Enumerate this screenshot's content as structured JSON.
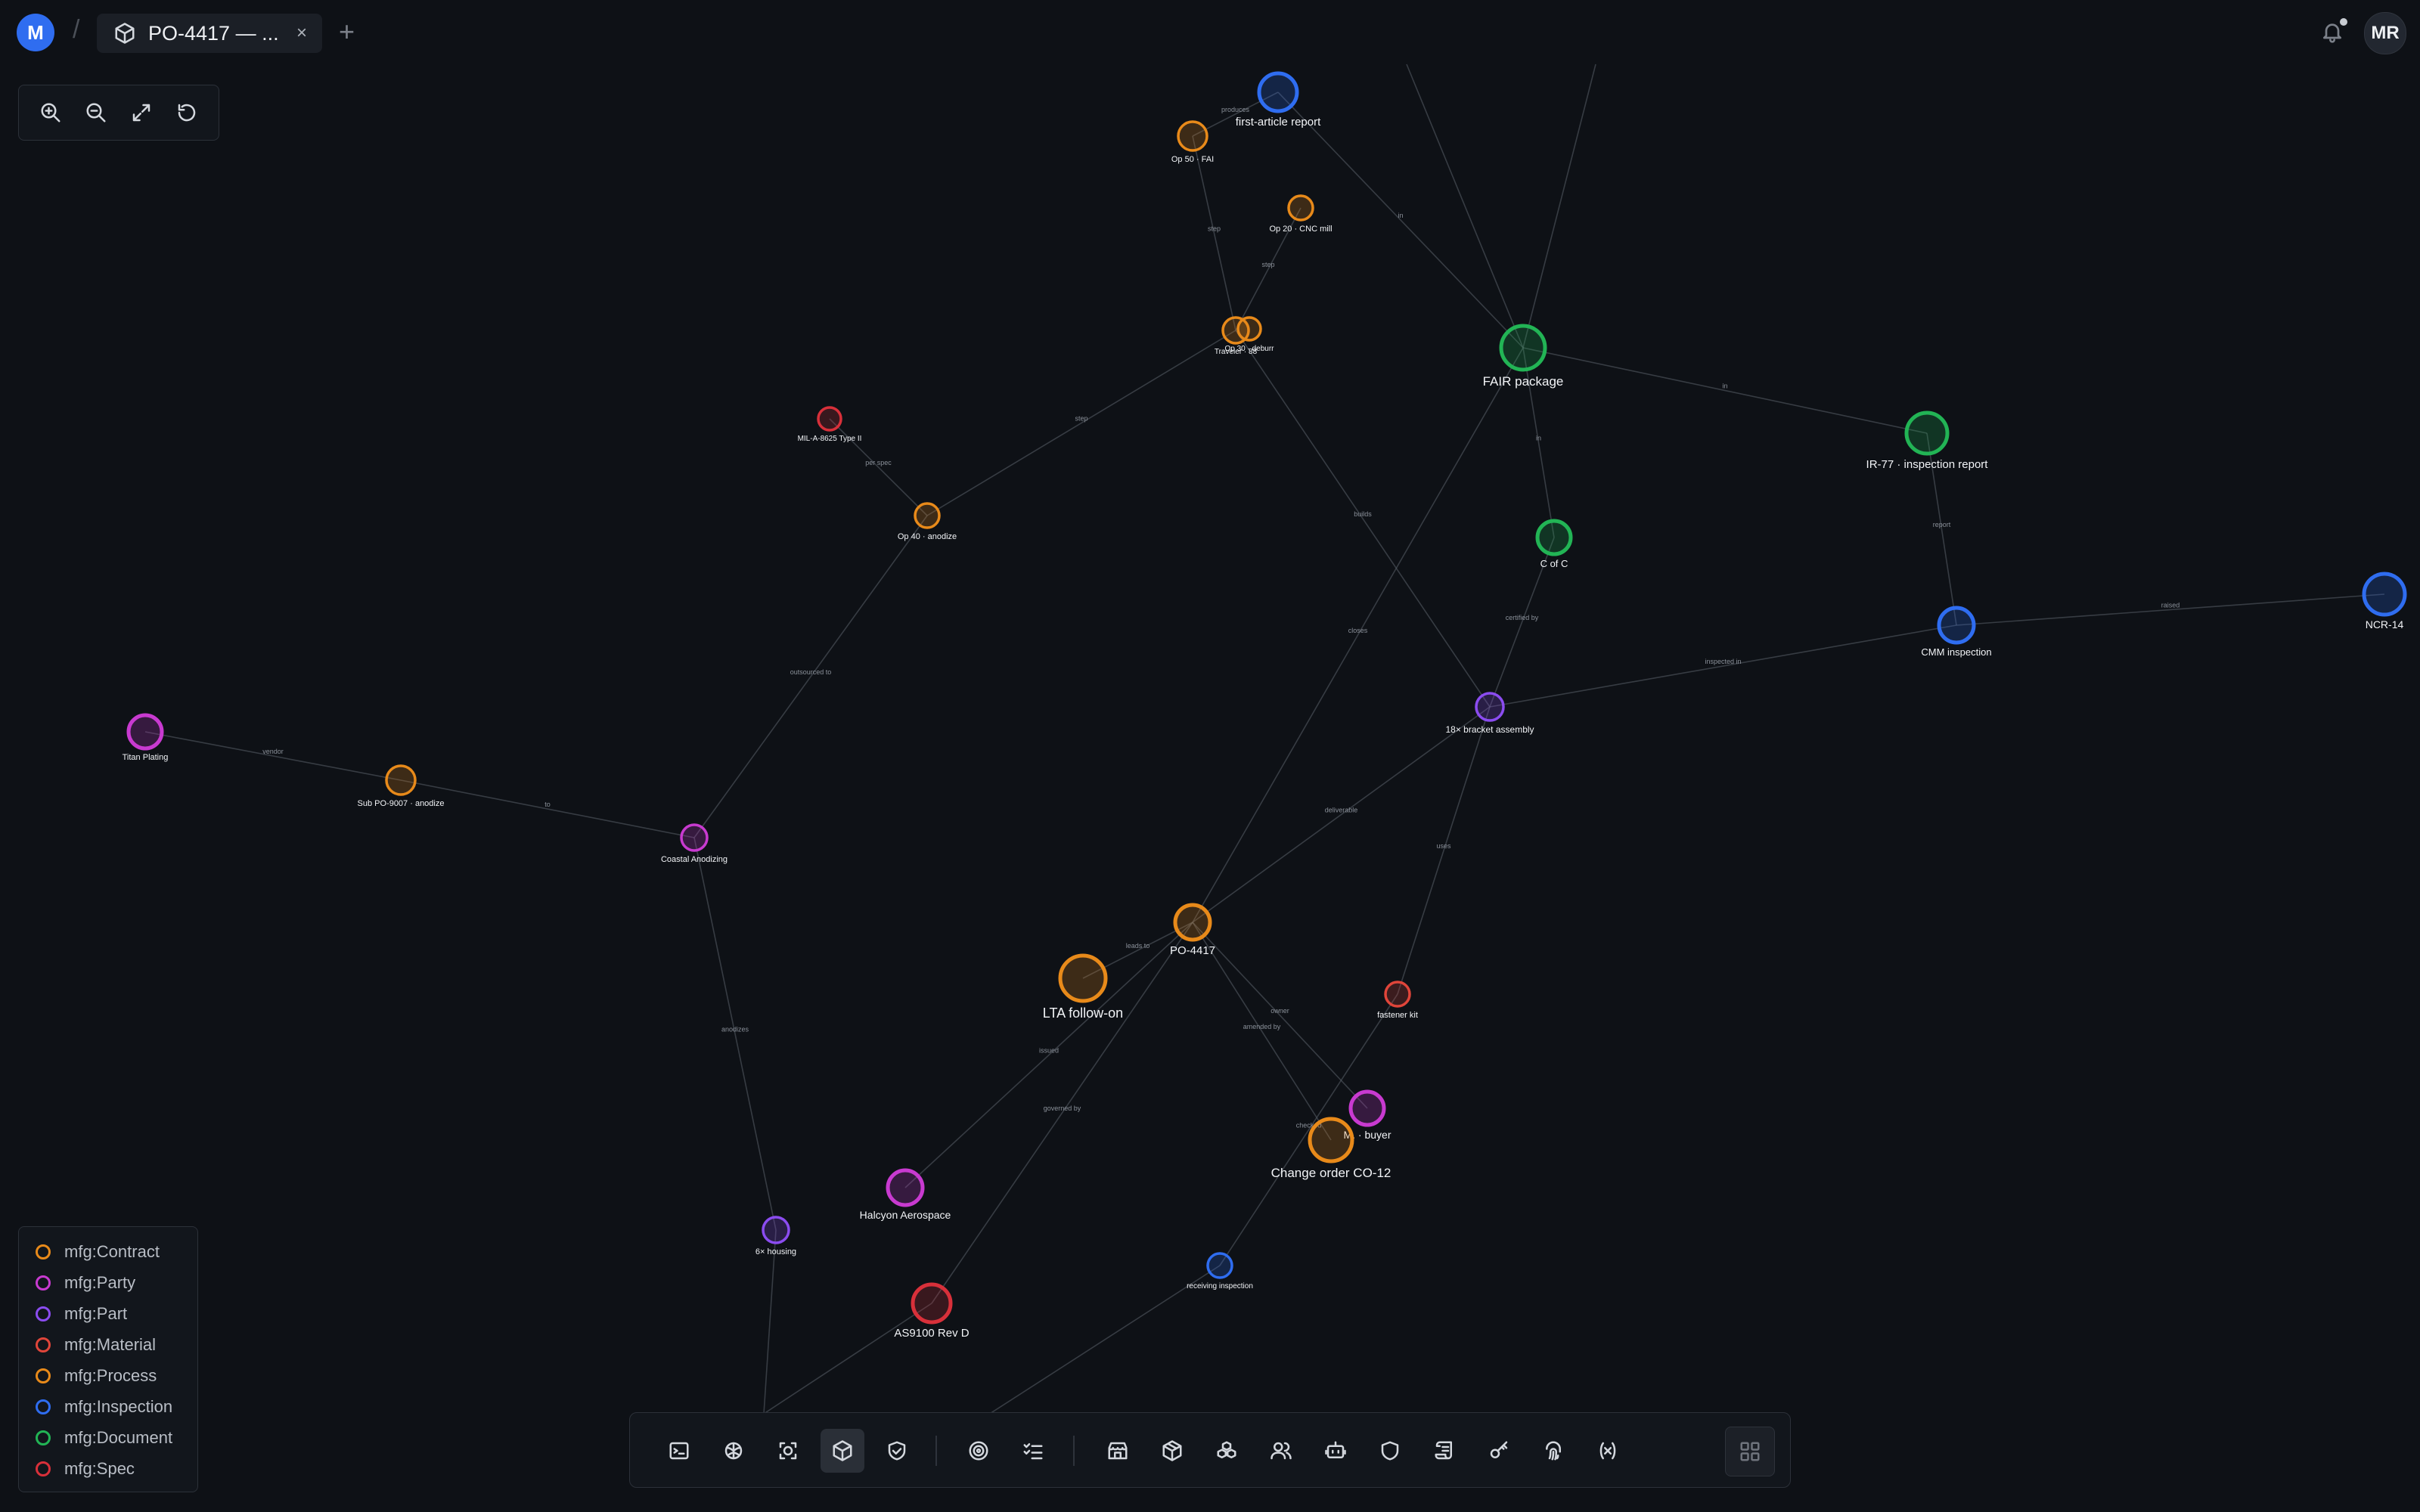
{
  "topbar": {
    "logo_letter": "M",
    "separator": "/",
    "tab_title": "PO-4417 — ...",
    "tab_close": "×",
    "new_tab": "+",
    "user_initials": "MR"
  },
  "zoom_controls": [
    "zoom-in",
    "zoom-out",
    "fit-view",
    "reset"
  ],
  "legend": [
    {
      "label": "mfg:Contract",
      "color": "#e88a1a"
    },
    {
      "label": "mfg:Party",
      "color": "#c83ad0"
    },
    {
      "label": "mfg:Part",
      "color": "#8b4cf0"
    },
    {
      "label": "mfg:Material",
      "color": "#e0453a"
    },
    {
      "label": "mfg:Process",
      "color": "#e88a1a"
    },
    {
      "label": "mfg:Inspection",
      "color": "#2f6df0"
    },
    {
      "label": "mfg:Document",
      "color": "#22b455"
    },
    {
      "label": "mfg:Spec",
      "color": "#d8303a"
    }
  ],
  "graph": {
    "nodes": [
      {
        "id": "fa_report",
        "label": "first-article report",
        "color": "#2f6df0"
      },
      {
        "id": "op50",
        "label": "Op 50 · FAI",
        "color": "#e88a1a"
      },
      {
        "id": "op20",
        "label": "Op 20 · CNC mill",
        "color": "#e88a1a"
      },
      {
        "id": "traveler",
        "label": "Traveler · 88",
        "color": "#e88a1a"
      },
      {
        "id": "op30",
        "label": "Op 30 · deburr",
        "color": "#e88a1a"
      },
      {
        "id": "fair",
        "label": "FAIR package",
        "color": "#22b455"
      },
      {
        "id": "ir77",
        "label": "IR-77 · inspection report",
        "color": "#22b455"
      },
      {
        "id": "mil",
        "label": "MIL-A-8625 Type II",
        "color": "#d8303a"
      },
      {
        "id": "op40",
        "label": "Op 40 · anodize",
        "color": "#e88a1a"
      },
      {
        "id": "cofc",
        "label": "C of C",
        "color": "#22b455"
      },
      {
        "id": "cmm",
        "label": "CMM inspection",
        "color": "#2f6df0"
      },
      {
        "id": "ncr14",
        "label": "NCR-14",
        "color": "#2f6df0"
      },
      {
        "id": "bracket",
        "label": "18× bracket assembly",
        "color": "#8b4cf0"
      },
      {
        "id": "titan",
        "label": "Titan Plating",
        "color": "#c83ad0"
      },
      {
        "id": "subpo",
        "label": "Sub PO-9007 · anodize",
        "color": "#e88a1a"
      },
      {
        "id": "coastal",
        "label": "Coastal Anodizing",
        "color": "#c83ad0"
      },
      {
        "id": "po4417",
        "label": "PO-4417",
        "color": "#e88a1a"
      },
      {
        "id": "lta",
        "label": "LTA follow-on",
        "color": "#e88a1a"
      },
      {
        "id": "fastener",
        "label": "fastener kit",
        "color": "#e0453a"
      },
      {
        "id": "buyer",
        "label": "M. · buyer",
        "color": "#c83ad0"
      },
      {
        "id": "co12",
        "label": "Change order CO-12",
        "color": "#e88a1a"
      },
      {
        "id": "halcyon",
        "label": "Halcyon Aerospace",
        "color": "#c83ad0"
      },
      {
        "id": "housing",
        "label": "6× housing",
        "color": "#8b4cf0"
      },
      {
        "id": "as9100",
        "label": "AS9100 Rev D",
        "color": "#d8303a"
      },
      {
        "id": "receiving",
        "label": "receiving inspection",
        "color": "#2f6df0"
      }
    ],
    "edges": [
      {
        "from": "op50",
        "to": "fa_report",
        "label": "produces"
      },
      {
        "from": "op50",
        "to": "traveler",
        "label": "step"
      },
      {
        "from": "op20",
        "to": "traveler",
        "label": "step"
      },
      {
        "from": "fa_report",
        "to": "fair",
        "label": "in"
      },
      {
        "from": "ir77",
        "to": "fair",
        "label": "in"
      },
      {
        "from": "fair",
        "to": "cofc",
        "label": "in"
      },
      {
        "from": "ir77",
        "to": "cmm",
        "label": "report"
      },
      {
        "from": "cmm",
        "to": "ncr14",
        "label": "raised"
      },
      {
        "from": "bracket",
        "to": "cmm",
        "label": "inspected in"
      },
      {
        "from": "cofc",
        "to": "bracket",
        "label": "certified by"
      },
      {
        "from": "traveler",
        "to": "bracket",
        "label": "builds"
      },
      {
        "from": "traveler",
        "to": "op40",
        "label": "step"
      },
      {
        "from": "mil",
        "to": "op40",
        "label": "per spec"
      },
      {
        "from": "op40",
        "to": "coastal",
        "label": "outsourced to"
      },
      {
        "from": "titan",
        "to": "subpo",
        "label": "vendor"
      },
      {
        "from": "subpo",
        "to": "coastal",
        "label": "to"
      },
      {
        "from": "fair",
        "to": "po4417",
        "label": "closes"
      },
      {
        "from": "bracket",
        "to": "po4417",
        "label": "deliverable"
      },
      {
        "from": "bracket",
        "to": "fastener",
        "label": "uses"
      },
      {
        "from": "po4417",
        "to": "lta",
        "label": "leads to"
      },
      {
        "from": "po4417",
        "to": "co12",
        "label": "amended by"
      },
      {
        "from": "po4417",
        "to": "buyer",
        "label": "owner"
      },
      {
        "from": "po4417",
        "to": "halcyon",
        "label": "issued"
      },
      {
        "from": "po4417",
        "to": "as9100",
        "label": "governed by"
      },
      {
        "from": "coastal",
        "to": "housing",
        "label": "anodizes"
      },
      {
        "from": "fastener",
        "to": "receiving",
        "label": "checked"
      }
    ]
  },
  "dock": {
    "tools": [
      "terminal-icon",
      "brain-icon",
      "scan-icon",
      "cube-icon",
      "shield-check-icon",
      "target-icon",
      "checklist-icon",
      "store-icon",
      "package-icon",
      "boxes-icon",
      "users-icon",
      "robot-icon",
      "shield-icon",
      "scroll-icon",
      "key-icon",
      "fingerprint-icon",
      "variable-icon"
    ],
    "active_tool": "cube-icon"
  }
}
